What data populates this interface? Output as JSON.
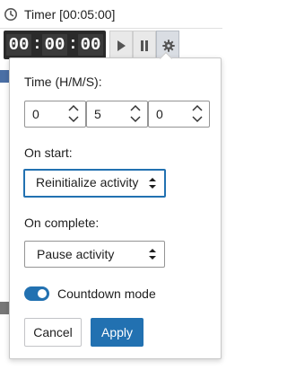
{
  "widget": {
    "title": "Timer [00:05:00]",
    "digits": {
      "hours": "00",
      "minutes": "00",
      "seconds": "00"
    },
    "separator": ":",
    "icons": [
      "clock-icon",
      "play-icon",
      "pause-icon",
      "gear-icon"
    ]
  },
  "popover": {
    "time_label": "Time (H/M/S):",
    "hours_value": "0",
    "minutes_value": "5",
    "seconds_value": "0",
    "on_start_label": "On start:",
    "on_start_selected": "Reinitialize activity",
    "on_complete_label": "On complete:",
    "on_complete_selected": "Pause activity",
    "countdown_label": "Countdown mode",
    "countdown_enabled": true,
    "cancel_label": "Cancel",
    "apply_label": "Apply"
  },
  "colors": {
    "accent": "#2271b1",
    "digit_bg": "#2a2a2a"
  }
}
